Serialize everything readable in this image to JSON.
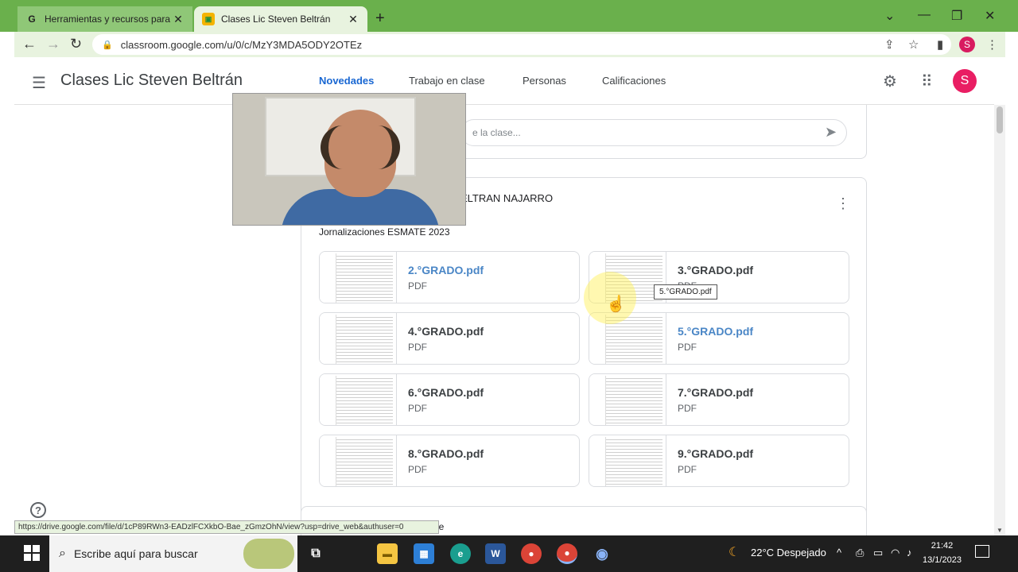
{
  "browser": {
    "tabs": [
      {
        "title": "Herramientas y recursos para la",
        "favicon": "google-icon",
        "active": false
      },
      {
        "title": "Clases Lic Steven Beltrán",
        "favicon": "classroom-icon",
        "active": true
      }
    ],
    "url": "classroom.google.com/u/0/c/MzY3MDA5ODY2OTEz",
    "profile_initial": "S",
    "status_url": "https://drive.google.com/file/d/1cP89RWn3-EADzlFCXkbO-Bae_zGmzOhN/view?usp=drive_web&authuser=0"
  },
  "classroom": {
    "class_title": "Clases Lic Steven Beltrán",
    "nav_tabs": [
      "Novedades",
      "Trabajo en clase",
      "Personas",
      "Calificaciones"
    ],
    "active_tab": "Novedades",
    "user_initial": "S",
    "comment_placeholder": "e la clase...",
    "post": {
      "author": "ELTRAN NAJARRO",
      "text": "Jornalizaciones ESMATE 2023",
      "attachments": [
        {
          "name": "2.°GRADO.pdf",
          "type": "PDF",
          "link": true
        },
        {
          "name": "3.°GRADO.pdf",
          "type": "PDF",
          "link": false
        },
        {
          "name": "4.°GRADO.pdf",
          "type": "PDF",
          "link": false
        },
        {
          "name": "5.°GRADO.pdf",
          "type": "PDF",
          "link": true
        },
        {
          "name": "6.°GRADO.pdf",
          "type": "PDF",
          "link": false
        },
        {
          "name": "7.°GRADO.pdf",
          "type": "PDF",
          "link": false
        },
        {
          "name": "8.°GRADO.pdf",
          "type": "PDF",
          "link": false
        },
        {
          "name": "9.°GRADO.pdf",
          "type": "PDF",
          "link": false
        }
      ]
    },
    "tooltip": "5.°GRADO.pdf",
    "next_post_fragment": "ase"
  },
  "taskbar": {
    "search_placeholder": "Escribe aquí para buscar",
    "weather": "22°C  Despejado",
    "time": "21:42",
    "date": "13/1/2023"
  },
  "colors": {
    "accent": "#1967d2",
    "tabbar": "#6ab04c",
    "avatar": "#e91e63"
  }
}
